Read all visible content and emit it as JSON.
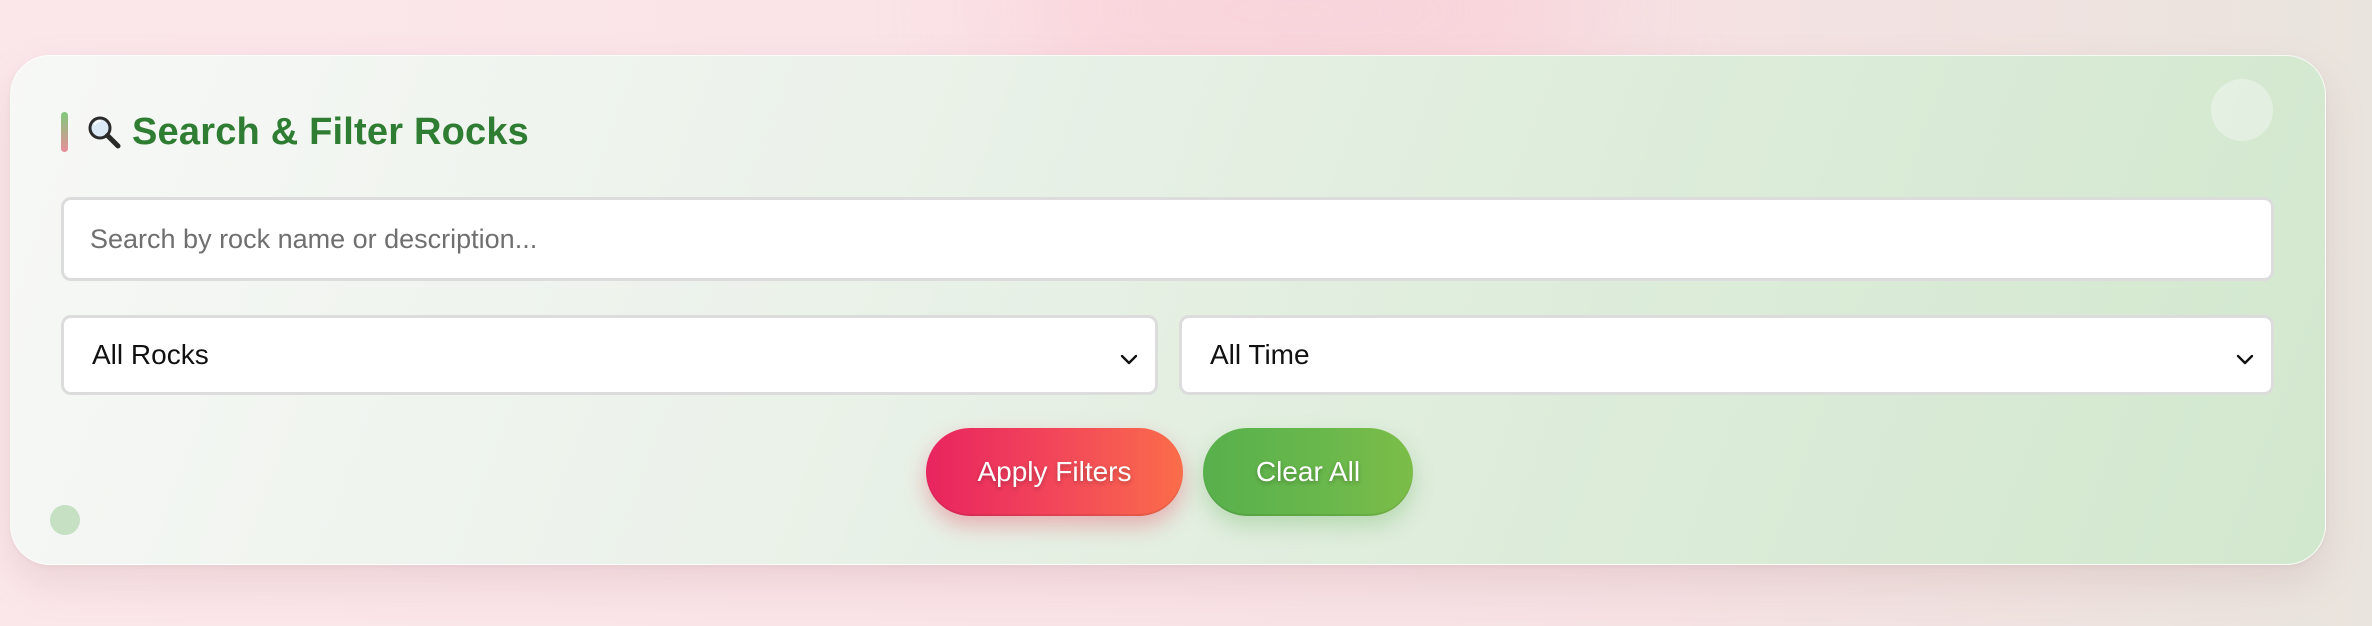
{
  "panel": {
    "title": "Search & Filter Rocks",
    "title_icon": "magnifying-glass-icon"
  },
  "search": {
    "placeholder": "Search by rock name or description...",
    "value": ""
  },
  "filters": {
    "rock_type": {
      "selected": "All Rocks",
      "icon": "chevron-down-icon"
    },
    "time_range": {
      "selected": "All Time",
      "icon": "chevron-down-icon"
    }
  },
  "actions": {
    "apply_label": "Apply Filters",
    "clear_label": "Clear All"
  },
  "colors": {
    "title": "#2e7d32",
    "apply_gradient_start": "#e8245f",
    "apply_gradient_end": "#fb6d4a",
    "clear_gradient_start": "#58b04c",
    "clear_gradient_end": "#7cbd48",
    "page_background": "#fae3e7",
    "card_background_end": "#d2e8ce"
  }
}
